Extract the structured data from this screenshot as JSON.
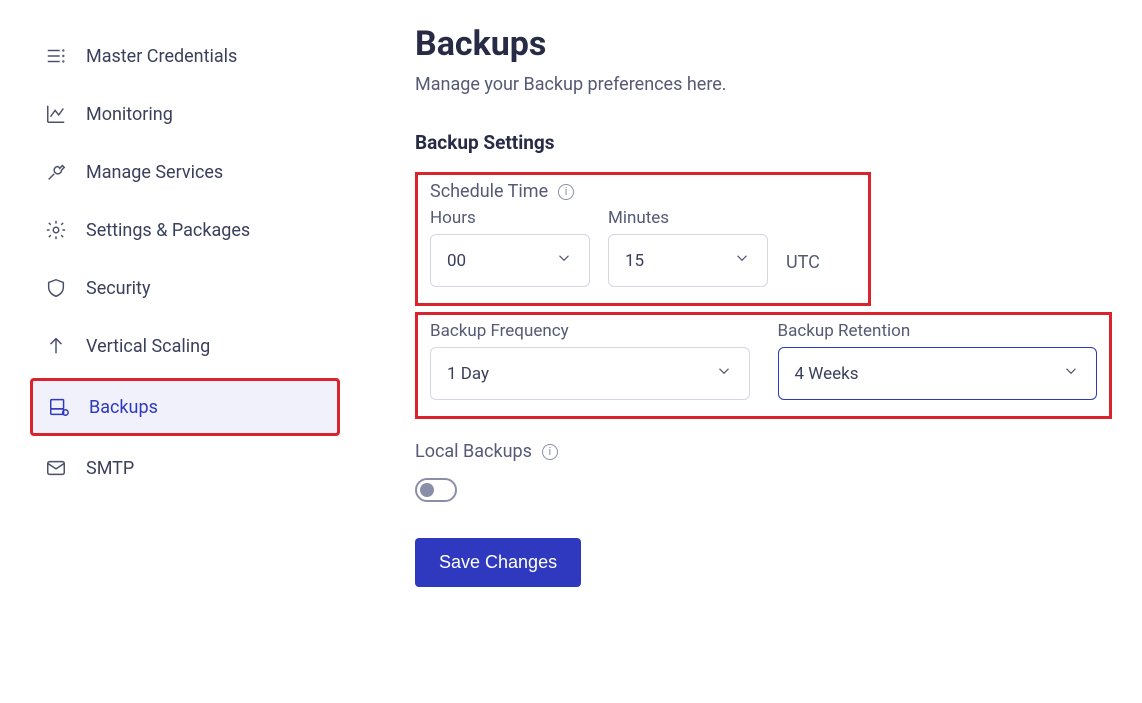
{
  "sidebar": {
    "items": [
      {
        "label": "Master Credentials",
        "icon": "list-icon"
      },
      {
        "label": "Monitoring",
        "icon": "chart-icon"
      },
      {
        "label": "Manage Services",
        "icon": "wrench-icon"
      },
      {
        "label": "Settings & Packages",
        "icon": "gear-icon"
      },
      {
        "label": "Security",
        "icon": "shield-icon"
      },
      {
        "label": "Vertical Scaling",
        "icon": "arrow-up-icon"
      },
      {
        "label": "Backups",
        "icon": "backup-icon"
      },
      {
        "label": "SMTP",
        "icon": "mail-icon"
      }
    ]
  },
  "main": {
    "title": "Backups",
    "subtitle": "Manage your Backup preferences here.",
    "settings_title": "Backup Settings",
    "schedule": {
      "label": "Schedule Time",
      "hours_label": "Hours",
      "minutes_label": "Minutes",
      "hours_value": "00",
      "minutes_value": "15",
      "tz": "UTC"
    },
    "frequency": {
      "freq_label": "Backup Frequency",
      "freq_value": "1 Day",
      "retention_label": "Backup Retention",
      "retention_value": "4 Weeks"
    },
    "local": {
      "label": "Local Backups",
      "enabled": false
    },
    "save_label": "Save Changes"
  }
}
